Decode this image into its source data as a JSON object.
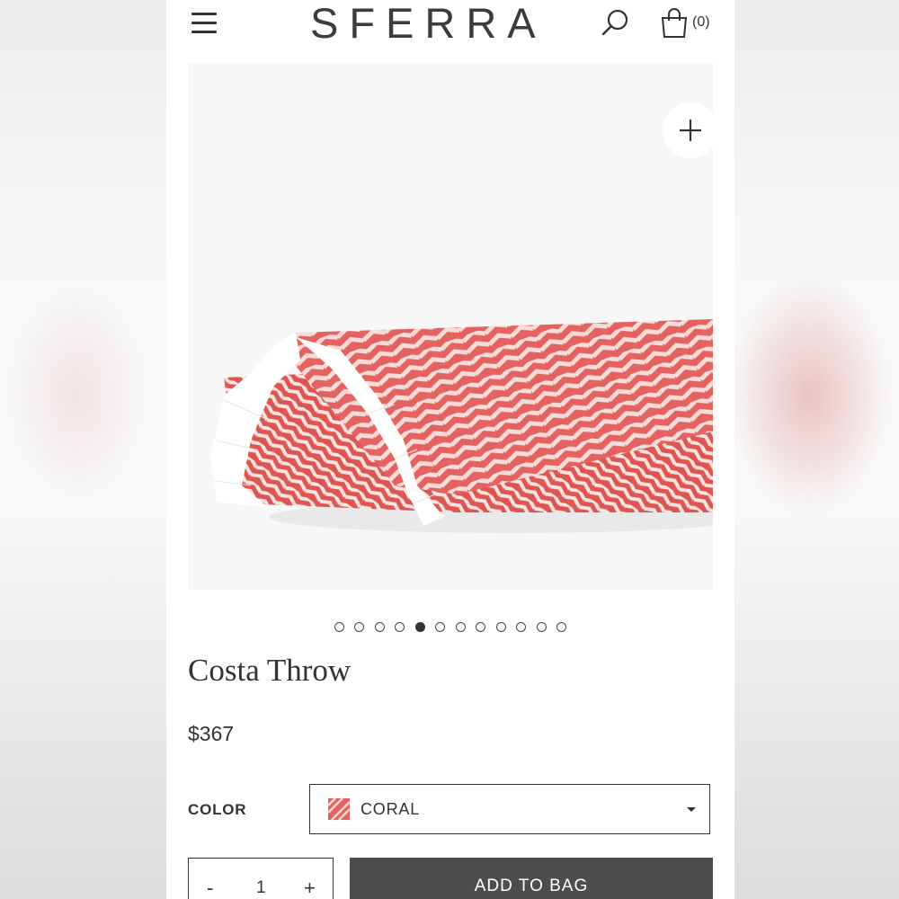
{
  "header": {
    "logo": "SFERRA",
    "bag_count": "(0)",
    "icons": [
      "menu-icon",
      "search-icon",
      "shopping-bag-icon"
    ]
  },
  "gallery": {
    "zoom_icon": "plus-icon",
    "image_count": 12,
    "active_index": 4,
    "product_colors": {
      "coral": "#e4625f",
      "fringe": "#ffffff",
      "background": "#f7f7f7"
    }
  },
  "product": {
    "title": "Costa Throw",
    "price": "$367"
  },
  "options": {
    "color_label": "COLOR",
    "color_value": "CORAL",
    "swatch_color": "#e4625f"
  },
  "purchase": {
    "minus": "-",
    "quantity": "1",
    "plus": "+",
    "add_to_bag": "ADD TO BAG",
    "button_color": "#4d4d4d"
  }
}
